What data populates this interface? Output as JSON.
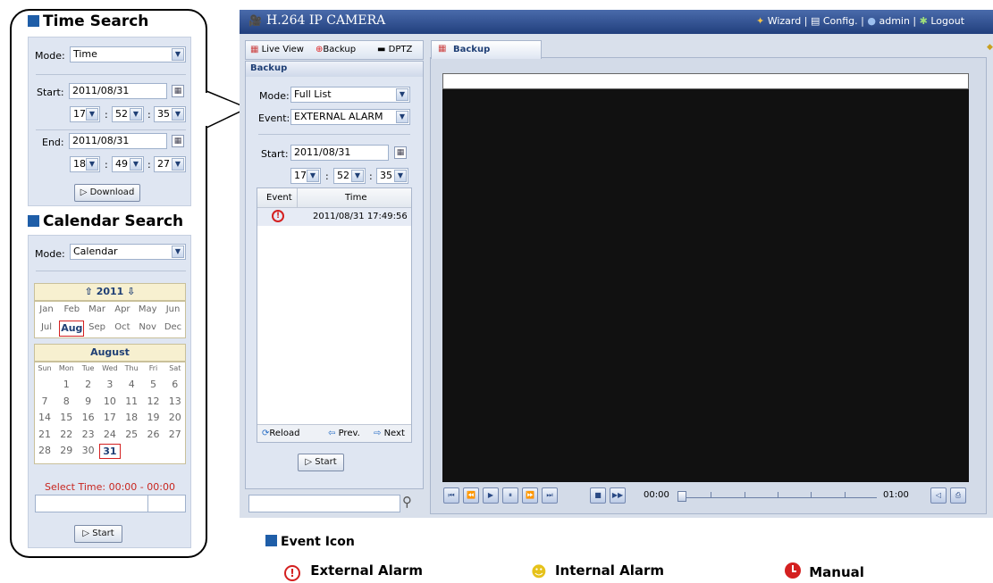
{
  "time_search": {
    "heading": "Time Search",
    "mode_label": "Mode:",
    "mode_value": "Time",
    "start_label": "Start:",
    "start_date": "2011/08/31",
    "start_h": "17",
    "start_m": "52",
    "start_s": "35",
    "end_label": "End:",
    "end_date": "2011/08/31",
    "end_h": "18",
    "end_m": "49",
    "end_s": "27",
    "download_label": "Download"
  },
  "calendar_search": {
    "heading": "Calendar Search",
    "mode_label": "Mode:",
    "mode_value": "Calendar",
    "year": "2011",
    "months_row1": [
      "Jan",
      "Feb",
      "Mar",
      "Apr",
      "May",
      "Jun"
    ],
    "months_row2": [
      "Jul",
      "Aug",
      "Sep",
      "Oct",
      "Nov",
      "Dec"
    ],
    "selected_month": "Aug",
    "month_title": "August",
    "weekdays": [
      "Sun",
      "Mon",
      "Tue",
      "Wed",
      "Thu",
      "Fri",
      "Sat"
    ],
    "weeks": [
      [
        "",
        "1",
        "2",
        "3",
        "4",
        "5",
        "6"
      ],
      [
        "7",
        "8",
        "9",
        "10",
        "11",
        "12",
        "13"
      ],
      [
        "14",
        "15",
        "16",
        "17",
        "18",
        "19",
        "20"
      ],
      [
        "21",
        "22",
        "23",
        "24",
        "25",
        "26",
        "27"
      ],
      [
        "28",
        "29",
        "30",
        "31",
        "",
        "",
        ""
      ]
    ],
    "selected_day": "31",
    "select_time_text": "Select Time: 00:00 - 00:00",
    "start_label": "Start"
  },
  "app": {
    "title": "H.264 IP CAMERA",
    "menu": {
      "wizard": "Wizard",
      "config": "Config.",
      "user": "admin",
      "logout": "Logout"
    }
  },
  "tabs": {
    "live": "Live View",
    "backup": "Backup",
    "ptz": "DPTZ"
  },
  "backup_panel": {
    "title": "Backup",
    "mode_label": "Mode:",
    "mode_value": "Full List",
    "event_label": "Event:",
    "event_value": "EXTERNAL ALARM",
    "start_label": "Start:",
    "start_date": "2011/08/31",
    "start_h": "17",
    "start_m": "52",
    "start_s": "35",
    "col_event": "Event",
    "col_time": "Time",
    "rows": [
      {
        "time": "2011/08/31 17:49:56"
      }
    ],
    "reload": "Reload",
    "prev": "Prev.",
    "next": "Next",
    "start_btn": "Start"
  },
  "viewer": {
    "tab": "Backup",
    "time_start": "00:00",
    "time_end": "01:00"
  },
  "legend": {
    "heading": "Event Icon",
    "external": "External Alarm",
    "internal": "Internal Alarm",
    "manual": "Manual"
  },
  "colors": {
    "accent": "#1f5ea8",
    "titlebar": "#2e4f8f",
    "video": "#111111",
    "alarm": "#d42020"
  }
}
